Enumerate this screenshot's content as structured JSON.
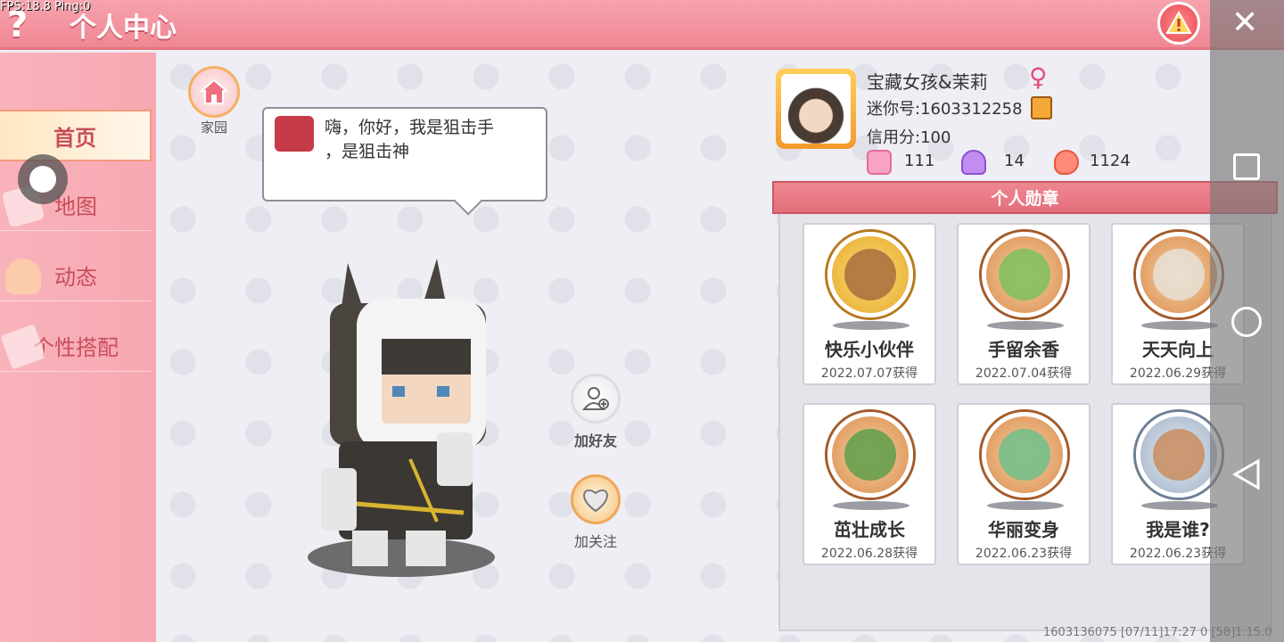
{
  "debug": {
    "fps": "FPS:18.8  Ping:0"
  },
  "header": {
    "title": "个人中心",
    "help": "?"
  },
  "sidebar": {
    "items": [
      {
        "label": "首页",
        "active": true
      },
      {
        "label": "地图"
      },
      {
        "label": "动态"
      },
      {
        "label": "个性搭配"
      }
    ]
  },
  "home": {
    "label": "家园"
  },
  "speech": {
    "text": "嗨，你好，我是狙击手\n，是狙击神"
  },
  "actions": {
    "add_friend": "加好友",
    "follow": "加关注"
  },
  "profile": {
    "name": "宝藏女孩&茉莉",
    "gender_symbol": "♀",
    "mini_id": "迷你号:1603312258",
    "credit": "信用分:100",
    "stats": [
      {
        "icon": "flag-icon",
        "value": "111"
      },
      {
        "icon": "crown-icon",
        "value": "14"
      },
      {
        "icon": "flame-icon",
        "value": "1124"
      }
    ]
  },
  "badges": {
    "title": "个人勋章",
    "items": [
      {
        "name": "快乐小伙伴",
        "date": "2022.07.07获得",
        "tier": "gold"
      },
      {
        "name": "手留余香",
        "date": "2022.07.04获得",
        "tier": "bronze"
      },
      {
        "name": "天天向上",
        "date": "2022.06.29获得",
        "tier": "bronze"
      },
      {
        "name": "茁壮成长",
        "date": "2022.06.28获得",
        "tier": "bronze"
      },
      {
        "name": "华丽变身",
        "date": "2022.06.23获得",
        "tier": "bronze"
      },
      {
        "name": "我是谁?",
        "date": "2022.06.23获得",
        "tier": "silver"
      }
    ]
  },
  "footer": {
    "text": "1603136075    [07/11]17:27 0  [58]1.15.0"
  },
  "colors": {
    "accent": "#ef8794",
    "sidebar": "#f9b3bb",
    "text": "#c94d5b"
  }
}
